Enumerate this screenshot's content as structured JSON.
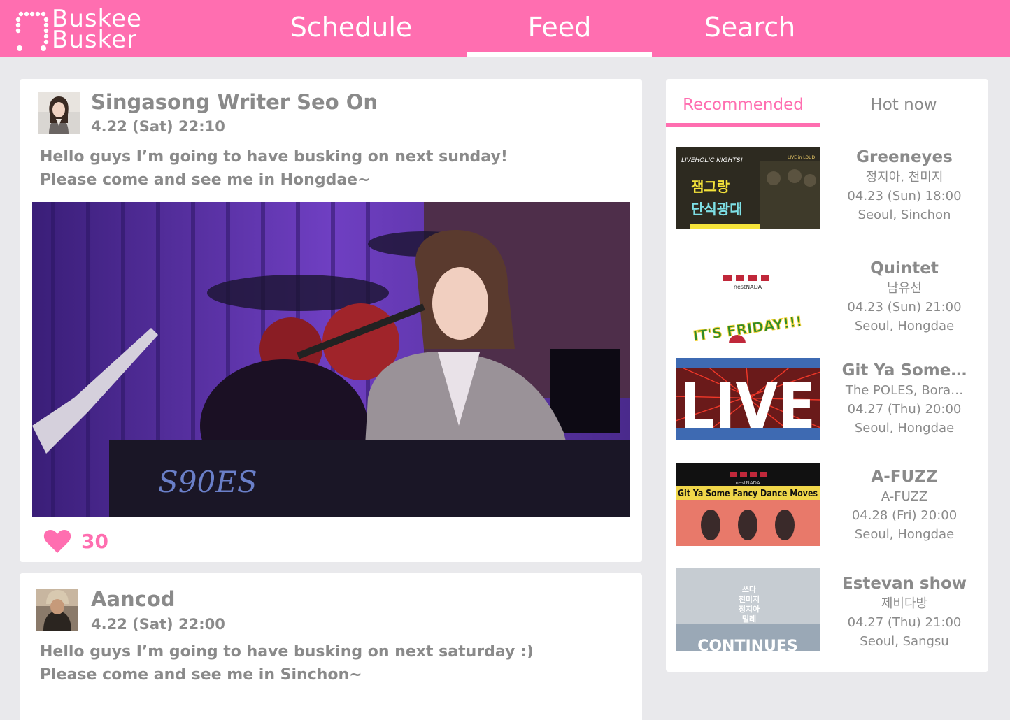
{
  "app": {
    "logo_line1": "Buskee",
    "logo_line2": "Busker"
  },
  "nav": {
    "tabs": [
      {
        "label": "Schedule"
      },
      {
        "label": "Feed",
        "active": true
      },
      {
        "label": "Search"
      }
    ]
  },
  "feed": {
    "posts": [
      {
        "author": "Singasong Writer Seo On",
        "time": "4.22 (Sat) 22:10",
        "text_line1": "Hello guys I’m going to have busking on next sunday!",
        "text_line2": "Please come and see me in Hongdae~",
        "photo_text": "S90ES",
        "likes": "30"
      },
      {
        "author": "Aancod",
        "time": "4.22 (Sat) 22:00",
        "text_line1": "Hello guys I’m going to have busking on next saturday :)",
        "text_line2": "Please come and see me in Sinchon~"
      }
    ]
  },
  "side": {
    "tabs": [
      {
        "label": "Recommended",
        "active": true
      },
      {
        "label": "Hot now"
      }
    ],
    "events": [
      {
        "title": "Greeneyes",
        "performers": "정지아, 천미지",
        "datetime": "04.23 (Sun) 18:00",
        "location": "Seoul, Sinchon",
        "poster_top": "LIVEHOLIC NIGHTS!",
        "poster_top_right": "LIVE in LOUD",
        "poster_text1": "잼그랑",
        "poster_text2": "단식광대"
      },
      {
        "title": "Quintet",
        "performers": "남유선",
        "datetime": "04.23 (Sun) 21:00",
        "location": "Seoul, Hongdae",
        "poster_logo": "nestNADA",
        "poster_text": "IT'S FRIDAY!!!"
      },
      {
        "title": "Git Ya Some…",
        "performers": "The POLES, Bora…",
        "datetime": "04.27 (Thu) 20:00",
        "location": "Seoul, Hongdae",
        "poster_text": "LIVE"
      },
      {
        "title": "A-FUZZ",
        "performers": "A-FUZZ",
        "datetime": "04.28 (Fri) 20:00",
        "location": "Seoul, Hongdae",
        "poster_logo": "nestNADA",
        "poster_text": "Git Ya Some Fancy Dance Moves"
      },
      {
        "title": "Estevan show",
        "performers": "제비다방",
        "datetime": "04.27 (Thu) 21:00",
        "location": "Seoul, Sangsu",
        "poster_text1": "쓰다",
        "poster_text2": "천미지",
        "poster_text3": "정지아",
        "poster_text4": "밀레",
        "poster_bottom": "CONTINUES"
      }
    ]
  },
  "colors": {
    "accent": "#ff6eb0",
    "background": "#e9e9ec",
    "text": "#8a8a8a"
  }
}
